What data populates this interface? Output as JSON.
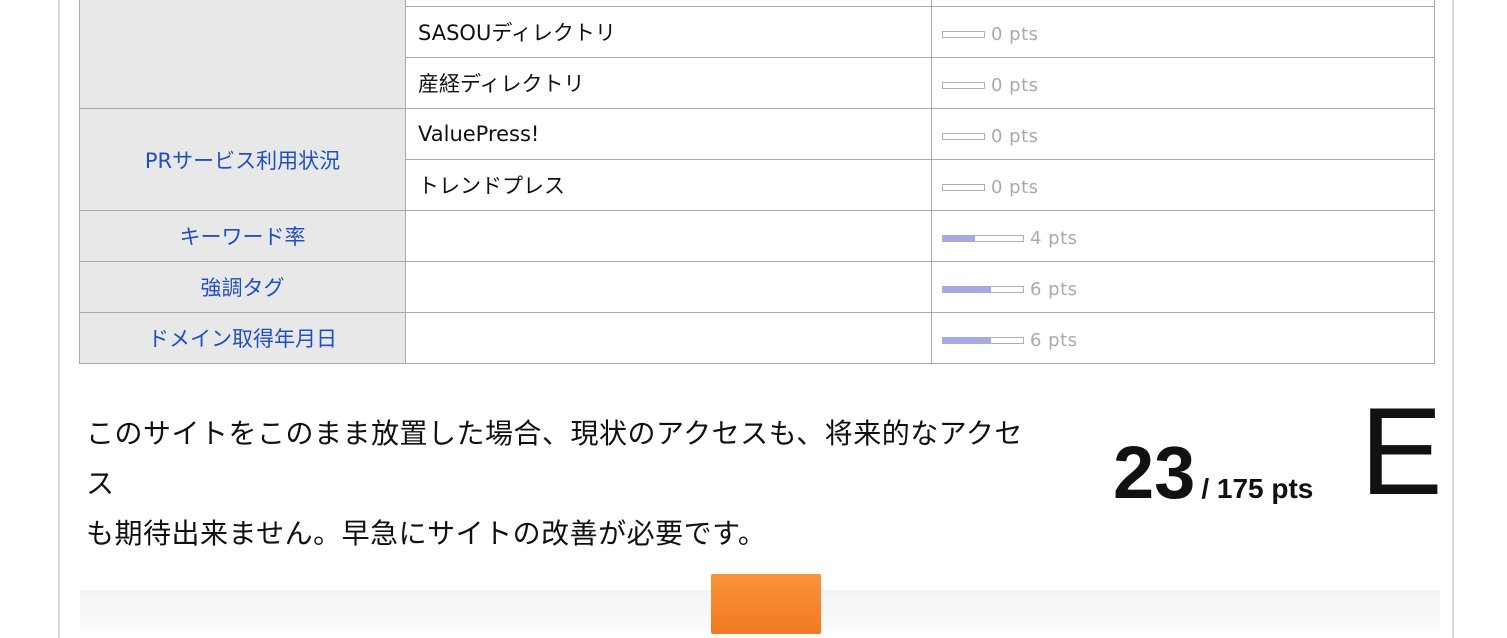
{
  "table": {
    "rows": [
      {
        "category": "",
        "item": "",
        "score": ""
      },
      {
        "category": "",
        "item": "SASOUディレクトリ",
        "score": "0 pts",
        "fill": 0
      },
      {
        "category": "",
        "item": "産経ディレクトリ",
        "score": "0 pts",
        "fill": 0
      },
      {
        "category": "PRサービス利用状況",
        "item": "ValuePress!",
        "score": "0 pts",
        "fill": 0
      },
      {
        "category": "",
        "item": "トレンドプレス",
        "score": "0 pts",
        "fill": 0
      },
      {
        "category": "キーワード率",
        "item": "",
        "score": "4 pts",
        "fill": 0.4
      },
      {
        "category": "強調タグ",
        "item": "",
        "score": "6 pts",
        "fill": 0.6
      },
      {
        "category": "ドメイン取得年月日",
        "item": "",
        "score": "6 pts",
        "fill": 0.6
      }
    ]
  },
  "summary": {
    "line1": "このサイトをこのまま放置した場合、現状のアクセスも、将来的なアクセス",
    "line2": "も期待出来ません。早急にサイトの改善が必要です。"
  },
  "total": {
    "score": "23",
    "max_label": "/ 175 pts",
    "grade": "E"
  },
  "colors": {
    "category_text": "#1f4fc4",
    "bar_fill": "#a8a8f0",
    "button_orange": "#f27a23"
  }
}
